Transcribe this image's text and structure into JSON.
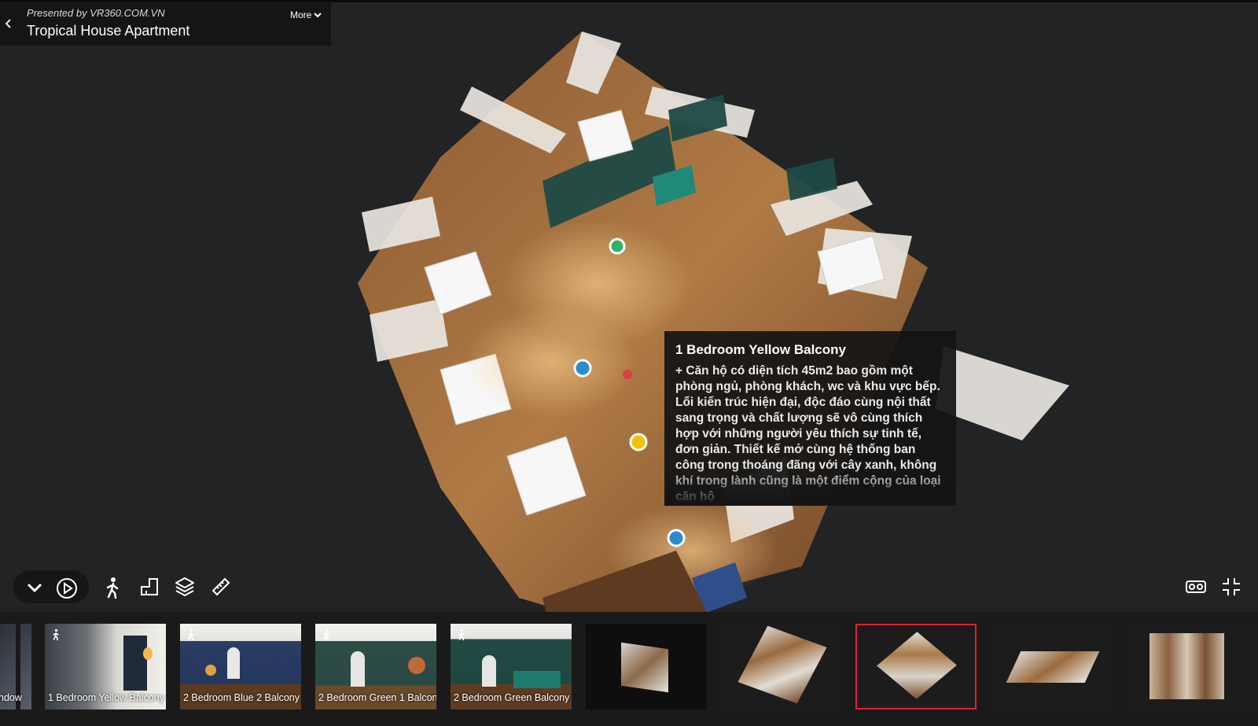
{
  "header": {
    "presented_by": "Presented by VR360.COM.VN",
    "title": "Tropical House Apartment",
    "more_label": "More"
  },
  "tooltip": {
    "title": "1 Bedroom Yellow Balcony",
    "body": "+ Căn hộ có diện tích 45m2 bao gồm một phòng ngủ, phòng khách, wc và khu vực bếp. Lối kiến trúc hiện đại, độc đáo cùng nội thất sang trọng và chất lượng sẽ vô cùng thích hợp với những người yêu thích sự tinh tế, đơn giản. Thiết kế mở cùng hệ thống ban công trong thoáng đãng với cây xanh, không khí trong lành cũng là một điểm cộng của loại căn hộ"
  },
  "toolbar": {
    "left_icons": [
      "collapse-chevron-icon",
      "play-icon",
      "walk-icon",
      "floorplan-icon",
      "layers-icon",
      "measure-ruler-icon"
    ],
    "right_icons": [
      "vr-headset-icon",
      "exit-fullscreen-icon"
    ]
  },
  "filmstrip": {
    "items": [
      {
        "label": "ndow",
        "kind": "room"
      },
      {
        "label": "1 Bedroom Yellow Balcony",
        "kind": "room"
      },
      {
        "label": "2 Bedroom Blue 2 Balcony",
        "kind": "room"
      },
      {
        "label": "2 Bedroom Green 1 Balcon",
        "kind": "room"
      },
      {
        "label": "2 Bedroom Green Balcony",
        "kind": "room"
      },
      {
        "label": "",
        "kind": "dollhouse"
      },
      {
        "label": "",
        "kind": "dollhouse"
      },
      {
        "label": "",
        "kind": "dollhouse",
        "selected": true
      },
      {
        "label": "",
        "kind": "dollhouse"
      },
      {
        "label": "",
        "kind": "floorplan"
      }
    ]
  },
  "colors": {
    "background": "#222325",
    "panel": "#141516",
    "selected_outline": "#e02030",
    "hotspot_blue": "#2a8bd0",
    "hotspot_green": "#2fb36a",
    "hotspot_yellow": "#f2c200"
  }
}
